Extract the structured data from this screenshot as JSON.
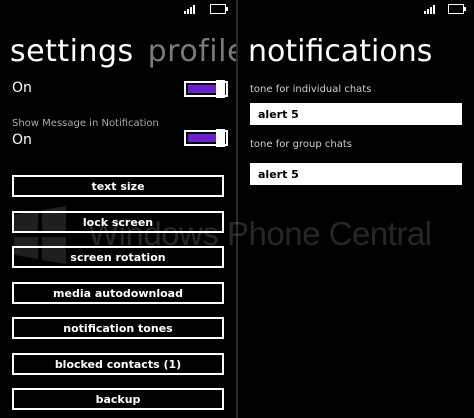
{
  "left": {
    "pivot": {
      "active": "settings",
      "inactive": "profile"
    },
    "toggles": [
      {
        "label": "",
        "state": "On",
        "on": true
      },
      {
        "label": "Show Message in Notification",
        "state": "On",
        "on": true
      }
    ],
    "buttons": [
      "text size",
      "lock screen",
      "screen rotation",
      "media autodownload",
      "notification tones",
      "blocked contacts (1)",
      "backup"
    ]
  },
  "right": {
    "title": "notifications",
    "fields": [
      {
        "label": "tone for individual chats",
        "value": "alert 5"
      },
      {
        "label": "tone for group chats",
        "value": "alert 5"
      }
    ]
  },
  "watermark": {
    "text": "Windows Phone Central"
  },
  "colors": {
    "accent": "#6a1fd1",
    "background": "#000000",
    "foreground": "#ffffff"
  }
}
